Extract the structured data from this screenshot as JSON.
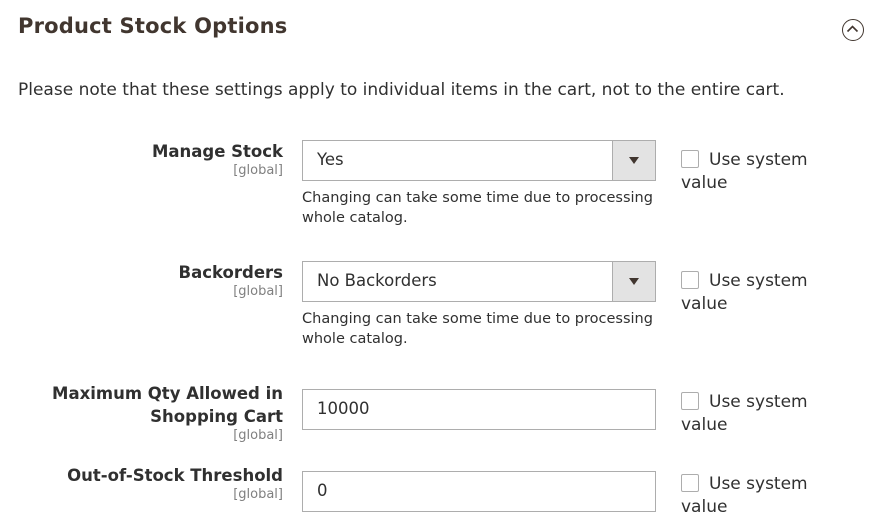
{
  "section": {
    "title": "Product Stock Options",
    "collapse_icon": "chevron-up-circle-icon",
    "note": "Please note that these settings apply to individual items in the cart, not to the entire cart."
  },
  "fields": [
    {
      "label": "Manage Stock",
      "scope": "[global]",
      "type": "select",
      "value": "Yes",
      "hint": "Changing can take some time due to processing whole catalog.",
      "use_system_value_label": "Use system value",
      "use_system_value_checked": false
    },
    {
      "label": "Backorders",
      "scope": "[global]",
      "type": "select",
      "value": "No Backorders",
      "hint": "Changing can take some time due to processing whole catalog.",
      "use_system_value_label": "Use system value",
      "use_system_value_checked": false
    },
    {
      "label_line1": "Maximum Qty Allowed in",
      "label_line2": "Shopping Cart",
      "scope": "[global]",
      "type": "text",
      "value": "10000",
      "use_system_value_label": "Use system value",
      "use_system_value_checked": false
    },
    {
      "label": "Out-of-Stock Threshold",
      "scope": "[global]",
      "type": "text",
      "value": "0",
      "use_system_value_label": "Use system value",
      "use_system_value_checked": false
    }
  ]
}
